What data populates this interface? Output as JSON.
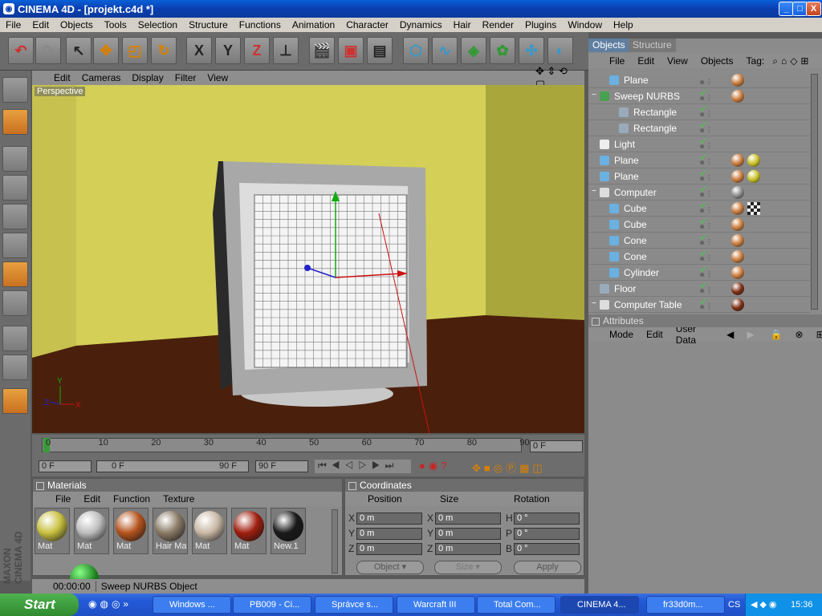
{
  "window": {
    "title": "CINEMA 4D - [projekt.c4d *]",
    "min": "_",
    "max": "□",
    "close": "X"
  },
  "menu": [
    "File",
    "Edit",
    "Objects",
    "Tools",
    "Selection",
    "Structure",
    "Functions",
    "Animation",
    "Character",
    "Dynamics",
    "Hair",
    "Render",
    "Plugins",
    "Window",
    "Help"
  ],
  "toolbar": {
    "x_label": "X",
    "y_label": "Y",
    "z_label": "Z"
  },
  "viewport": {
    "menu": [
      "Edit",
      "Cameras",
      "Display",
      "Filter",
      "View"
    ],
    "label": "Perspective",
    "axis_x": "X",
    "axis_y": "Y",
    "axis_z": "Z"
  },
  "timeline": {
    "ticks": [
      "0",
      "10",
      "20",
      "30",
      "40",
      "50",
      "60",
      "70",
      "80",
      "90"
    ],
    "current": "0 F",
    "start": "0 F",
    "range_start": "0 F",
    "range_end": "90 F",
    "end": "90 F"
  },
  "materials": {
    "title": "Materials",
    "menu": [
      "File",
      "Edit",
      "Function",
      "Texture"
    ],
    "items": [
      {
        "name": "Mat",
        "color": "#c8c040"
      },
      {
        "name": "Mat",
        "color": "#bdbdbd"
      },
      {
        "name": "Mat",
        "color": "#b5541d"
      },
      {
        "name": "Hair Mat",
        "color": "#8a7a66"
      },
      {
        "name": "Mat",
        "color": "#c9b8a6"
      },
      {
        "name": "Mat",
        "color": "#a02010"
      },
      {
        "name": "New.1",
        "color": "#1a1a1a"
      }
    ]
  },
  "coords": {
    "title": "Coordinates",
    "col_position": "Position",
    "col_size": "Size",
    "col_rotation": "Rotation",
    "rows": [
      {
        "pl": "X",
        "pv": "0 m",
        "sl": "X",
        "sv": "0 m",
        "rl": "H",
        "rv": "0 °"
      },
      {
        "pl": "Y",
        "pv": "0 m",
        "sl": "Y",
        "sv": "0 m",
        "rl": "P",
        "rv": "0 °"
      },
      {
        "pl": "Z",
        "pv": "0 m",
        "sl": "Z",
        "sv": "0 m",
        "rl": "B",
        "rv": "0 °"
      }
    ],
    "mode": "Object",
    "size_mode": "Size",
    "apply": "Apply"
  },
  "status": {
    "time": "00:00:00",
    "text": "Sweep NURBS Object"
  },
  "objects": {
    "tabs": [
      "Objects",
      "Structure"
    ],
    "menu": [
      "File",
      "Edit",
      "View",
      "Objects",
      "Tag:"
    ],
    "rows": [
      {
        "name": "Plane",
        "indent": 1,
        "icon": "plane-icon",
        "tags": [
          "phong"
        ]
      },
      {
        "name": "Sweep NURBS",
        "indent": 0,
        "icon": "sweep-icon",
        "tags": [
          "phong"
        ],
        "expand": "−"
      },
      {
        "name": "Rectangle",
        "indent": 2,
        "icon": "spline-icon",
        "tags": []
      },
      {
        "name": "Rectangle",
        "indent": 2,
        "icon": "spline-icon",
        "tags": []
      },
      {
        "name": "Light",
        "indent": 0,
        "icon": "light-icon",
        "tags": []
      },
      {
        "name": "Plane",
        "indent": 0,
        "icon": "plane-icon",
        "tags": [
          "phong",
          "yellow"
        ]
      },
      {
        "name": "Plane",
        "indent": 0,
        "icon": "plane-icon",
        "tags": [
          "phong",
          "yellow"
        ]
      },
      {
        "name": "Computer",
        "indent": 0,
        "icon": "null-icon",
        "tags": [
          "gray"
        ],
        "expand": "−"
      },
      {
        "name": "Cube",
        "indent": 1,
        "icon": "cube-icon",
        "tags": [
          "phong",
          "checker"
        ]
      },
      {
        "name": "Cube",
        "indent": 1,
        "icon": "cube-icon",
        "tags": [
          "phong"
        ]
      },
      {
        "name": "Cone",
        "indent": 1,
        "icon": "cone-icon",
        "tags": [
          "phong"
        ]
      },
      {
        "name": "Cone",
        "indent": 1,
        "icon": "cone-icon",
        "tags": [
          "phong"
        ]
      },
      {
        "name": "Cylinder",
        "indent": 1,
        "icon": "cylinder-icon",
        "tags": [
          "phong"
        ]
      },
      {
        "name": "Floor",
        "indent": 0,
        "icon": "floor-icon",
        "tags": [
          "brown"
        ]
      },
      {
        "name": "Computer Table",
        "indent": 0,
        "icon": "null-icon",
        "tags": [
          "brown"
        ],
        "expand": "−"
      }
    ]
  },
  "attributes": {
    "title": "Attributes",
    "menu": [
      "Mode",
      "Edit",
      "User Data"
    ]
  },
  "taskbar": {
    "start": "Start",
    "tasks": [
      "Windows ...",
      "PB009 - Ci...",
      "Správce s...",
      "Warcraft III",
      "Total Com...",
      "CINEMA 4...",
      "fr33d0m..."
    ],
    "lang": "CS",
    "clock": "15:36"
  }
}
